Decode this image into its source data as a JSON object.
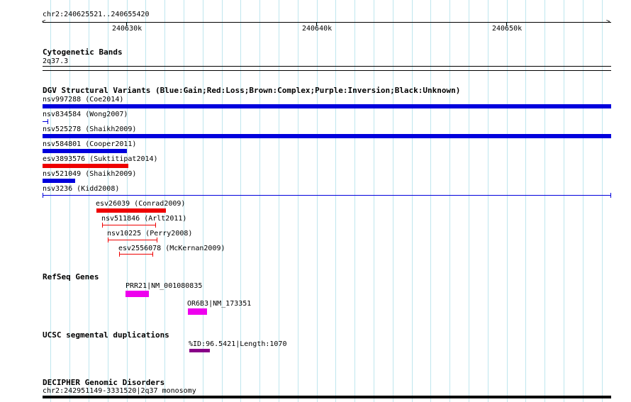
{
  "ruler": {
    "location": "chr2:240625521..240655420",
    "ticks": [
      "240630k",
      "240640k",
      "240650k"
    ]
  },
  "cytoband": {
    "title": "Cytogenetic Bands",
    "band": "2q37.3"
  },
  "dgv": {
    "title": "DGV Structural Variants (Blue:Gain;Red:Loss;Brown:Complex;Purple:Inversion;Black:Unknown)",
    "colors": {
      "gain": "#0000dd",
      "loss": "#ee0000"
    },
    "items": [
      {
        "label": "nsv997288 (Coe2014)"
      },
      {
        "label": "nsv834584 (Wong2007)"
      },
      {
        "label": "nsv525278 (Shaikh2009)"
      },
      {
        "label": "nsv584801 (Cooper2011)"
      },
      {
        "label": "esv3893576 (Suktitipat2014)"
      },
      {
        "label": "nsv521049 (Shaikh2009)"
      },
      {
        "label": "nsv3236 (Kidd2008)"
      },
      {
        "label": "esv26039 (Conrad2009)"
      },
      {
        "label": "nsv511846 (Arlt2011)"
      },
      {
        "label": "nsv10225 (Perry2008)"
      },
      {
        "label": "esv2556078 (McKernan2009)"
      }
    ]
  },
  "refseq": {
    "title": "RefSeq Genes",
    "color": "#ee00ee",
    "items": [
      {
        "label": "PRR21|NM_001080835"
      },
      {
        "label": "OR6B3|NM_173351"
      }
    ]
  },
  "segdup": {
    "title": "UCSC segmental duplications",
    "color": "#880088",
    "items": [
      {
        "label": "%ID:96.5421|Length:1070"
      }
    ]
  },
  "decipher": {
    "title": "DECIPHER Genomic Disorders",
    "items": [
      {
        "label": "chr2:242951149-3331520|2q37 monosomy"
      }
    ]
  }
}
